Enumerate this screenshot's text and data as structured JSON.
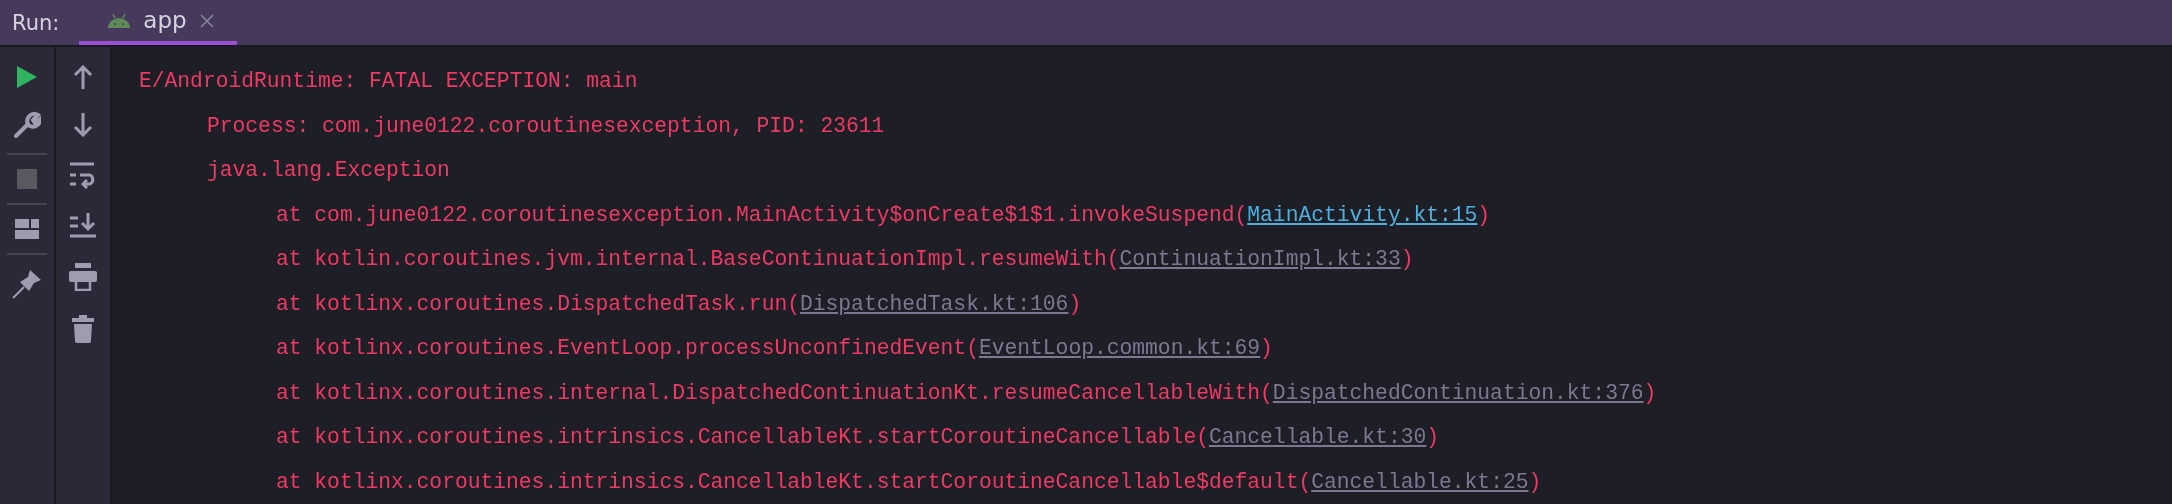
{
  "header": {
    "label": "Run:"
  },
  "tabs": [
    {
      "label": "app",
      "selected": true
    }
  ],
  "console": [
    {
      "kind": "header",
      "text": "E/AndroidRuntime: FATAL EXCEPTION: main"
    },
    {
      "kind": "detail",
      "text": "Process: com.june0122.coroutinesexception, PID: 23611"
    },
    {
      "kind": "detail",
      "text": "java.lang.Exception"
    },
    {
      "kind": "frame",
      "text": "at com.june0122.coroutinesexception.MainActivity$onCreate$1$1.invokeSuspend(",
      "link": {
        "text": "MainActivity.kt:15",
        "kind": "source"
      },
      "after": ")"
    },
    {
      "kind": "frame",
      "text": "at kotlin.coroutines.jvm.internal.BaseContinuationImpl.resumeWith(",
      "link": {
        "text": "ContinuationImpl.kt:33",
        "kind": "library"
      },
      "after": ")"
    },
    {
      "kind": "frame",
      "text": "at kotlinx.coroutines.DispatchedTask.run(",
      "link": {
        "text": "DispatchedTask.kt:106",
        "kind": "library"
      },
      "after": ")"
    },
    {
      "kind": "frame",
      "text": "at kotlinx.coroutines.EventLoop.processUnconfinedEvent(",
      "link": {
        "text": "EventLoop.common.kt:69",
        "kind": "library"
      },
      "after": ")"
    },
    {
      "kind": "frame",
      "text": "at kotlinx.coroutines.internal.DispatchedContinuationKt.resumeCancellableWith(",
      "link": {
        "text": "DispatchedContinuation.kt:376",
        "kind": "library"
      },
      "after": ")"
    },
    {
      "kind": "frame",
      "text": "at kotlinx.coroutines.intrinsics.CancellableKt.startCoroutineCancellable(",
      "link": {
        "text": "Cancellable.kt:30",
        "kind": "library"
      },
      "after": ")"
    },
    {
      "kind": "frame",
      "text": "at kotlinx.coroutines.intrinsics.CancellableKt.startCoroutineCancellable$default(",
      "link": {
        "text": "Cancellable.kt:25",
        "kind": "library"
      },
      "after": ")"
    }
  ]
}
